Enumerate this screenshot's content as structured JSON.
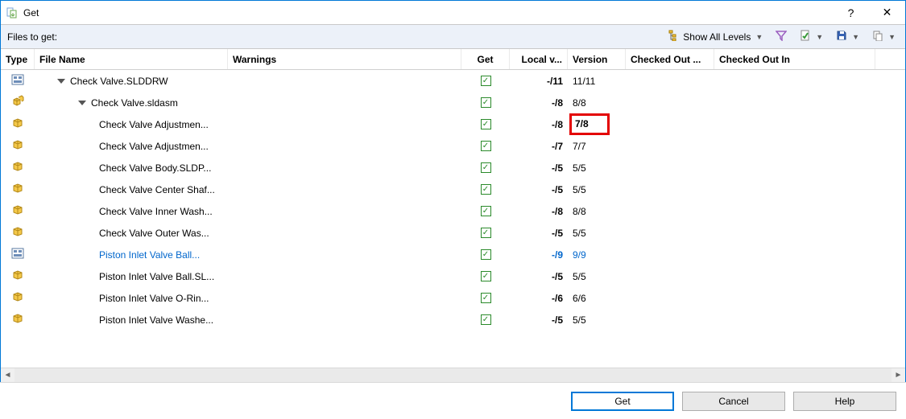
{
  "window": {
    "title": "Get",
    "help_symbol": "?",
    "close_symbol": "✕"
  },
  "toolbar": {
    "files_label": "Files to get:",
    "show_all_levels": "Show All Levels"
  },
  "columns": {
    "type": "Type",
    "file_name": "File Name",
    "warnings": "Warnings",
    "get": "Get",
    "local_v": "Local v...",
    "version": "Version",
    "checked_out_by": "Checked Out ...",
    "checked_out_in": "Checked Out In"
  },
  "rows": [
    {
      "icon": "drawing",
      "indent": 1,
      "toggle": true,
      "name": "Check Valve.SLDDRW",
      "get": true,
      "local": "-/11",
      "version": "11/11",
      "link": false,
      "highlight": false
    },
    {
      "icon": "asm",
      "indent": 2,
      "toggle": true,
      "name": "Check Valve.sldasm",
      "get": true,
      "local": "-/8",
      "version": "8/8",
      "link": false,
      "highlight": false
    },
    {
      "icon": "part",
      "indent": 3,
      "toggle": false,
      "name": "Check Valve Adjustmen...",
      "get": true,
      "local": "-/8",
      "version": "7/8",
      "link": false,
      "highlight": true
    },
    {
      "icon": "part",
      "indent": 3,
      "toggle": false,
      "name": "Check Valve Adjustmen...",
      "get": true,
      "local": "-/7",
      "version": "7/7",
      "link": false,
      "highlight": false
    },
    {
      "icon": "part",
      "indent": 3,
      "toggle": false,
      "name": "Check Valve Body.SLDP...",
      "get": true,
      "local": "-/5",
      "version": "5/5",
      "link": false,
      "highlight": false
    },
    {
      "icon": "part",
      "indent": 3,
      "toggle": false,
      "name": "Check Valve Center Shaf...",
      "get": true,
      "local": "-/5",
      "version": "5/5",
      "link": false,
      "highlight": false
    },
    {
      "icon": "part",
      "indent": 3,
      "toggle": false,
      "name": "Check Valve Inner Wash...",
      "get": true,
      "local": "-/8",
      "version": "8/8",
      "link": false,
      "highlight": false
    },
    {
      "icon": "part",
      "indent": 3,
      "toggle": false,
      "name": "Check Valve Outer Was...",
      "get": true,
      "local": "-/5",
      "version": "5/5",
      "link": false,
      "highlight": false
    },
    {
      "icon": "drawing",
      "indent": 3,
      "toggle": false,
      "name": "Piston Inlet Valve Ball...",
      "get": true,
      "local": "-/9",
      "version": "9/9",
      "link": true,
      "highlight": false
    },
    {
      "icon": "part",
      "indent": 3,
      "toggle": false,
      "name": "Piston Inlet Valve Ball.SL...",
      "get": true,
      "local": "-/5",
      "version": "5/5",
      "link": false,
      "highlight": false
    },
    {
      "icon": "part",
      "indent": 3,
      "toggle": false,
      "name": "Piston Inlet Valve O-Rin...",
      "get": true,
      "local": "-/6",
      "version": "6/6",
      "link": false,
      "highlight": false
    },
    {
      "icon": "part",
      "indent": 3,
      "toggle": false,
      "name": "Piston Inlet Valve Washe...",
      "get": true,
      "local": "-/5",
      "version": "5/5",
      "link": false,
      "highlight": false
    }
  ],
  "buttons": {
    "get": "Get",
    "cancel": "Cancel",
    "help": "Help"
  }
}
